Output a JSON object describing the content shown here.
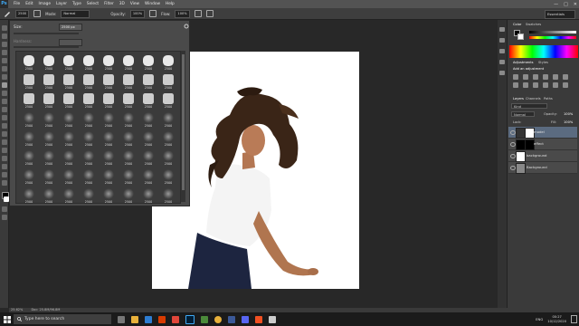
{
  "app": {
    "logo": "Ps",
    "menus": [
      "File",
      "Edit",
      "Image",
      "Layer",
      "Type",
      "Select",
      "Filter",
      "3D",
      "View",
      "Window",
      "Help"
    ]
  },
  "window_controls": [
    "—",
    "□",
    "✕"
  ],
  "options_bar": {
    "brush_size": "2500",
    "mode_label": "Mode:",
    "mode_value": "Normal",
    "opacity_label": "Opacity:",
    "opacity_value": "100%",
    "flow_label": "Flow:",
    "flow_value": "100%",
    "workspace": "Essentials"
  },
  "brush_panel": {
    "size_label": "Size:",
    "size_value": "2500 px",
    "hardness_label": "Hardness:",
    "row_numbers": [
      "2500",
      "2500",
      "2500",
      "2500",
      "2500",
      "2500",
      "2500",
      "2500"
    ]
  },
  "right_panel": {
    "tabs_top": [
      "Color",
      "Swatches"
    ],
    "adjust_tabs": [
      "Adjustments",
      "Styles"
    ],
    "adjust_title": "Add an adjustment",
    "layer_tabs": [
      "Layers",
      "Channels",
      "Paths"
    ],
    "kind_label": "Kind",
    "blend_mode": "Normal",
    "opacity_label": "Opacity:",
    "opacity_value": "100%",
    "lock_label": "Lock:",
    "fill_label": "Fill:",
    "fill_value": "100%",
    "layers": [
      {
        "name": "model"
      },
      {
        "name": "effect"
      },
      {
        "name": "background"
      },
      {
        "name": "Background"
      }
    ]
  },
  "status_bar": {
    "zoom": "25.62%",
    "doc": "Doc: 25.8M/96.8M"
  },
  "taskbar": {
    "search_placeholder": "Type here to search",
    "language": "ENG",
    "time": "00:27",
    "date": "10/12/2020"
  },
  "colors": {
    "menubar": "#535353",
    "panel": "#3a3a3a",
    "accent": "#3fa9f5"
  }
}
